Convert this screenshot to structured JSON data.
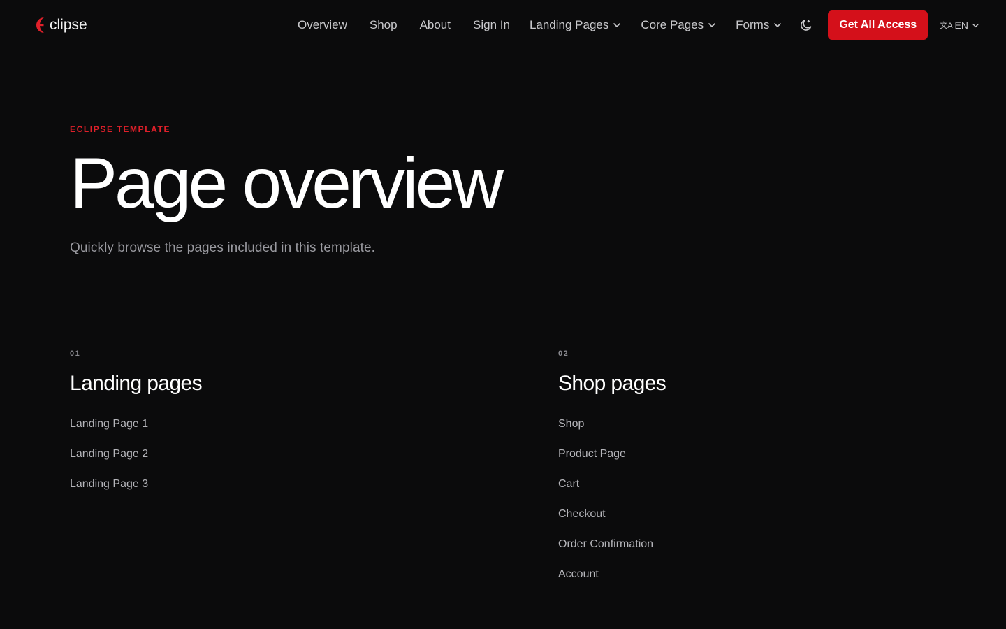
{
  "brand": {
    "name": "clipse",
    "accent_color": "#d4101a",
    "logo_icon": "crescent-e-icon"
  },
  "nav": {
    "links": [
      {
        "label": "Overview"
      },
      {
        "label": "Shop"
      },
      {
        "label": "About"
      },
      {
        "label": "Sign In"
      }
    ],
    "dropdowns": [
      {
        "label": "Landing Pages",
        "icon": "chevron-down-icon"
      },
      {
        "label": "Core Pages",
        "icon": "chevron-down-icon"
      },
      {
        "label": "Forms",
        "icon": "chevron-down-icon"
      }
    ],
    "theme_toggle_icon": "moon-icon",
    "cta_label": "Get All Access",
    "language": {
      "selected": "EN",
      "icon": "translate-icon"
    }
  },
  "hero": {
    "eyebrow": "ECLIPSE TEMPLATE",
    "title": "Page overview",
    "subtitle": "Quickly browse the pages included in this template."
  },
  "sections": [
    {
      "number": "01",
      "title": "Landing pages",
      "pages": [
        "Landing Page 1",
        "Landing Page 2",
        "Landing Page 3"
      ]
    },
    {
      "number": "02",
      "title": "Shop pages",
      "pages": [
        "Shop",
        "Product Page",
        "Cart",
        "Checkout",
        "Order Confirmation",
        "Account"
      ]
    }
  ]
}
